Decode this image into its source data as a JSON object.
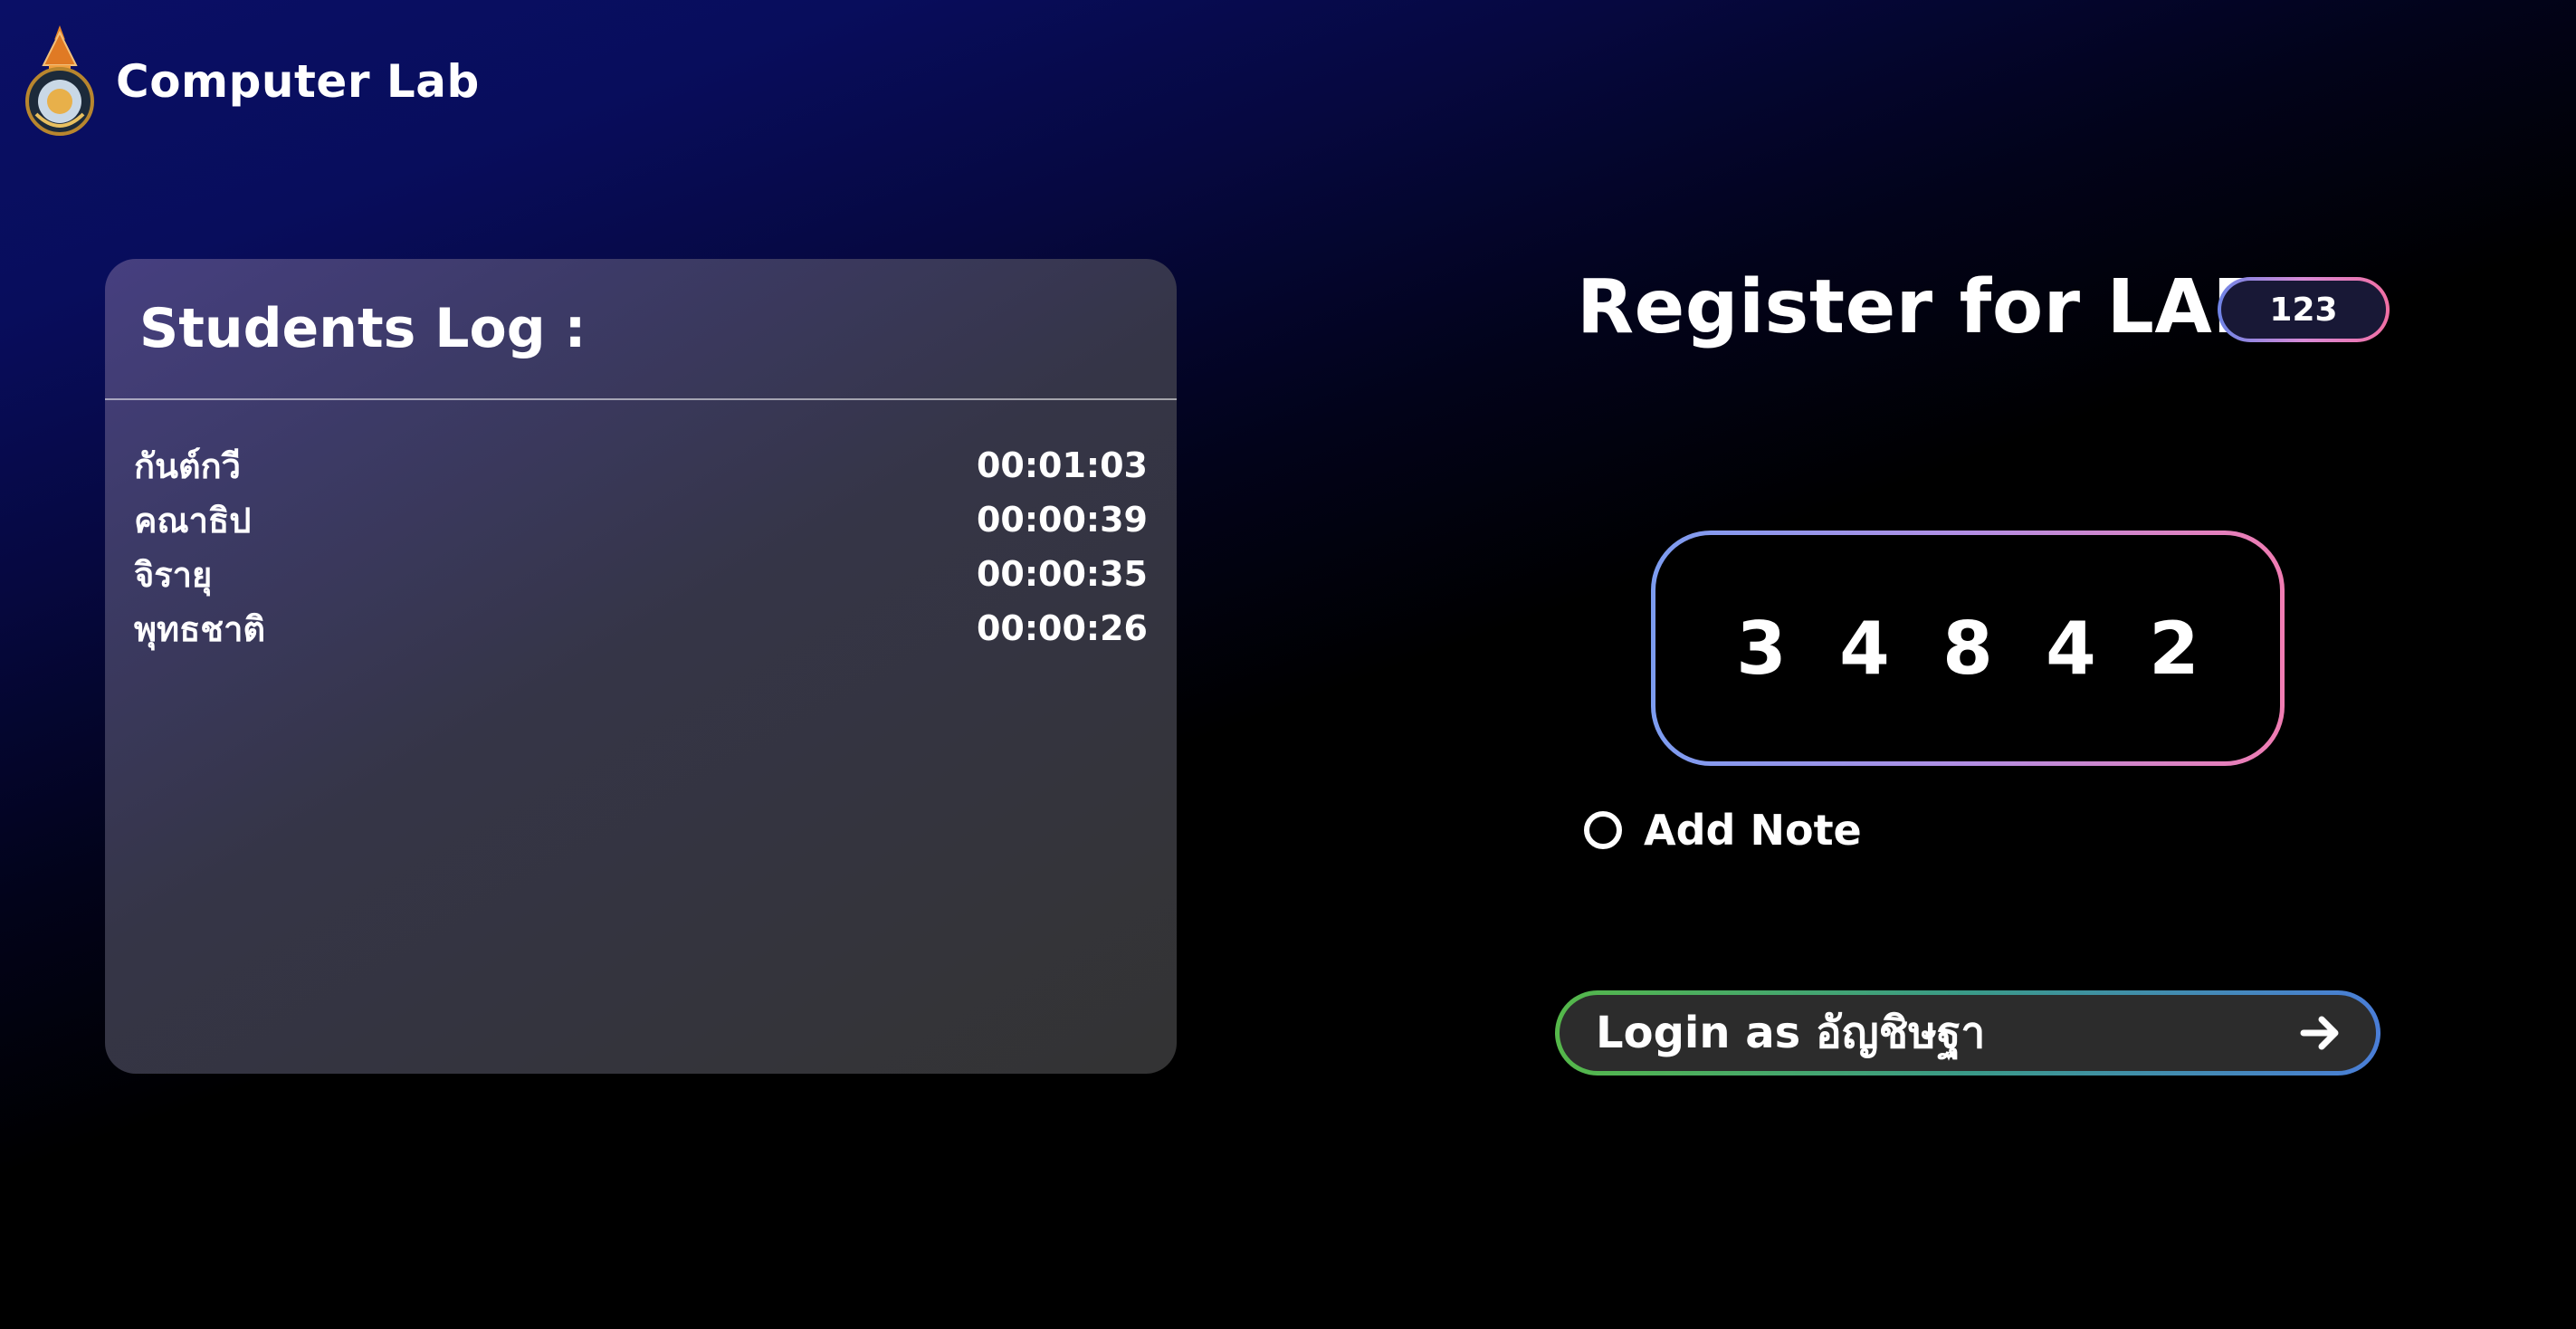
{
  "brand": {
    "title": "Computer Lab",
    "logo_icon": "school-emblem-icon"
  },
  "students_log": {
    "title": "Students Log :",
    "entries": [
      {
        "name": "กันต์กวี",
        "time": "00:01:03"
      },
      {
        "name": "คณาธิป",
        "time": "00:00:39"
      },
      {
        "name": "จิรายุ",
        "time": "00:00:35"
      },
      {
        "name": "พุทธชาติ",
        "time": "00:00:26"
      }
    ]
  },
  "register": {
    "title": "Register for LAB",
    "badge": "123",
    "pin_digits": [
      "3",
      "4",
      "8",
      "4",
      "2"
    ],
    "note_label": "Add Note",
    "login_label": "Login as อัญชิษฐา",
    "login_icon": "arrow-right-icon"
  },
  "colors": {
    "background_top": "#0a0f66",
    "card": "#333333",
    "pin_border_start": "#7c9cf0",
    "pin_border_end": "#f07cb2",
    "login_border_start": "#55b84a",
    "login_border_end": "#4a7ed8"
  }
}
